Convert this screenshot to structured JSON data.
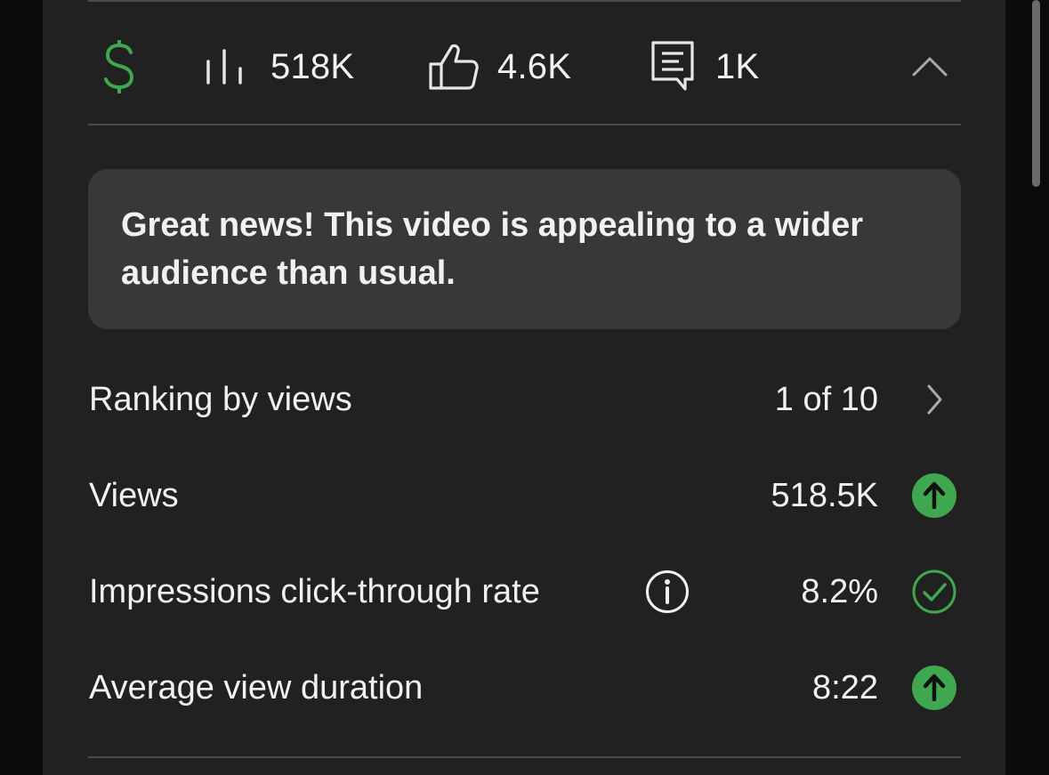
{
  "stats": {
    "revenue_icon": "dollar-icon",
    "views_icon": "bar-chart-icon",
    "views": "518K",
    "likes_icon": "thumbs-up-icon",
    "likes": "4.6K",
    "comments_icon": "comment-icon",
    "comments": "1K",
    "collapse_icon": "chevron-up-icon"
  },
  "banner": {
    "text": "Great news! This video is appealing to a wider audience than usual."
  },
  "metrics": [
    {
      "label": "Ranking by views",
      "value": "1 of 10",
      "status_icon": "chevron-right-icon"
    },
    {
      "label": "Views",
      "value": "518.5K",
      "status_icon": "arrow-up-circle-icon"
    },
    {
      "label": "Impressions click-through rate",
      "value": "8.2%",
      "info_icon": "info-icon",
      "status_icon": "check-circle-icon"
    },
    {
      "label": "Average view duration",
      "value": "8:22",
      "status_icon": "arrow-up-circle-icon"
    }
  ],
  "colors": {
    "background": "#0b0b0b",
    "panel": "#212121",
    "banner": "#383838",
    "divider": "#4a4a4a",
    "accent_green": "#3ea74f",
    "text": "#f1f1f1",
    "muted_icon": "#aaaaaa"
  }
}
